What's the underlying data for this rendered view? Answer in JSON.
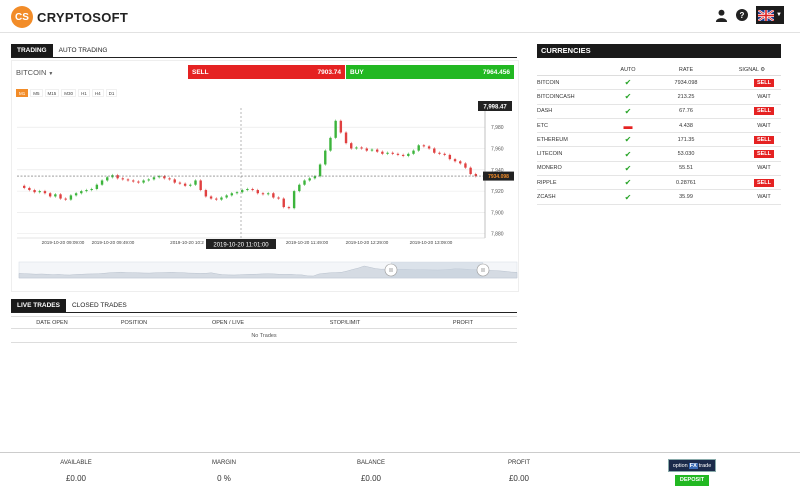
{
  "header": {
    "logo_mark": "CS",
    "logo_text": "CRYPTOSOFT"
  },
  "trading": {
    "tabs": [
      "TRADING",
      "AUTO TRADING"
    ],
    "asset": "BITCOIN",
    "sell_label": "SELL",
    "sell_price": "7903.74",
    "buy_label": "BUY",
    "buy_price": "7964.456",
    "timeframes": [
      "M1",
      "M5",
      "M15",
      "M30",
      "H1",
      "H4",
      "D1"
    ],
    "active_timeframe": "M1"
  },
  "chart_data": {
    "type": "line",
    "style": "candlestick",
    "x_ticks": [
      "2019-10-20 09:09:00",
      "2019-10-20 09:49:00",
      "2019-10-20 10:2",
      "2019-10-20 11:01:00",
      "2019-10-20 11:49:00",
      "2019-10-20 12:29:00",
      "2019-10-20 13:09:00"
    ],
    "y_ticks": [
      "7,980",
      "7,960",
      "7,940",
      "7,920",
      "7,900",
      "7,880"
    ],
    "ylim": [
      7876,
      7998
    ],
    "crosshair_price": "7,998.47",
    "crosshair_time": "2019-10-20 11:01:00",
    "current_price": "7934.098",
    "series": [
      {
        "values": [
          7925,
          7923,
          7921,
          7919,
          7920,
          7918,
          7915,
          7917,
          7913,
          7912,
          7916,
          7918,
          7920,
          7921,
          7922,
          7926,
          7930,
          7933,
          7935,
          7932,
          7931,
          7930,
          7929,
          7928,
          7930,
          7931,
          7933,
          7934,
          7932,
          7931,
          7928,
          7927,
          7925,
          7926,
          7930,
          7921,
          7915,
          7913,
          7912,
          7914,
          7916,
          7918,
          7919,
          7921,
          7922,
          7921,
          7918,
          7917,
          7918,
          7914,
          7913,
          7905,
          7904,
          7920,
          7926,
          7930,
          7932,
          7934,
          7945,
          7958,
          7970,
          7986,
          7975,
          7965,
          7960,
          7961,
          7960,
          7958,
          7959,
          7957,
          7955,
          7956,
          7955,
          7954,
          7953,
          7955,
          7958,
          7963,
          7962,
          7960,
          7956,
          7955,
          7954,
          7950,
          7948,
          7946,
          7942,
          7936,
          7934
        ]
      }
    ]
  },
  "live_trades": {
    "tabs": [
      "LIVE TRADES",
      "CLOSED TRADES"
    ],
    "columns": [
      "DATE OPEN",
      "POSITION",
      "OPEN / LIVE",
      "STOP/LIMIT",
      "PROFIT"
    ],
    "empty_text": "No Trades"
  },
  "currencies": {
    "title": "CURRENCIES",
    "columns": [
      "AUTO",
      "RATE",
      "SIGNAL"
    ],
    "rows": [
      {
        "name": "BITCOIN",
        "auto": "check",
        "rate": "7934.098",
        "signal": "SELL"
      },
      {
        "name": "BITCOINCASH",
        "auto": "check",
        "rate": "213.25",
        "signal": "WAIT"
      },
      {
        "name": "DASH",
        "auto": "check",
        "rate": "67.76",
        "signal": "SELL"
      },
      {
        "name": "ETC",
        "auto": "minus",
        "rate": "4.438",
        "signal": "WAIT"
      },
      {
        "name": "ETHEREUM",
        "auto": "check",
        "rate": "171.35",
        "signal": "SELL"
      },
      {
        "name": "LITECOIN",
        "auto": "check",
        "rate": "53.030",
        "signal": "SELL"
      },
      {
        "name": "MONERO",
        "auto": "check",
        "rate": "55.51",
        "signal": "WAIT"
      },
      {
        "name": "RIPPLE",
        "auto": "check",
        "rate": "0.28761",
        "signal": "SELL"
      },
      {
        "name": "ZCASH",
        "auto": "check",
        "rate": "35.99",
        "signal": "WAIT"
      }
    ]
  },
  "footer": {
    "available_label": "AVAILABLE",
    "available_value": "£0.00",
    "margin_label": "MARGIN",
    "margin_value": "0 %",
    "balance_label": "BALANCE",
    "balance_value": "£0.00",
    "profit_label": "PROFIT",
    "profit_value": "£0.00",
    "partner_left": "option",
    "partner_fx": "FX",
    "partner_right": "trade",
    "deposit_label": "DEPOSIT"
  },
  "colors": {
    "brand_orange": "#f28c28",
    "sell_red": "#e52222",
    "buy_green": "#22b822",
    "dark": "#1a1a1a"
  }
}
